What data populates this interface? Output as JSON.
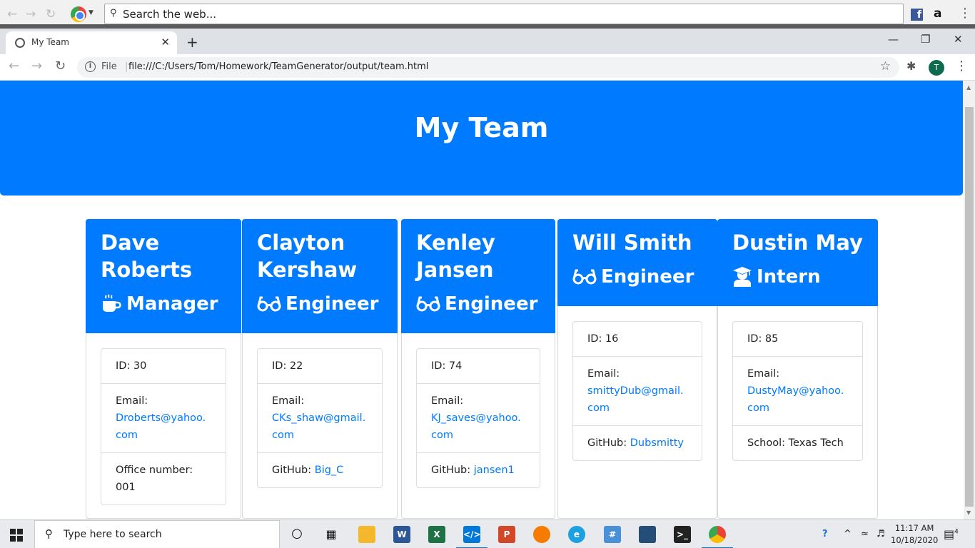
{
  "outer": {
    "search_placeholder": "Search the web..."
  },
  "browser": {
    "tab_title": "My Team",
    "file_label": "File",
    "url": "file:///C:/Users/Tom/Homework/TeamGenerator/output/team.html",
    "profile_initial": "T"
  },
  "page": {
    "title": "My Team",
    "members": [
      {
        "name": "Dave Roberts",
        "role": "Manager",
        "icon": "coffee-icon",
        "id_text": "ID: 30",
        "email_label": "Email:",
        "email": "Droberts@yahoo.com",
        "extra_label": "Office number:",
        "extra_value": "001"
      },
      {
        "name": "Clayton Kershaw",
        "role": "Engineer",
        "icon": "glasses-icon",
        "id_text": "ID: 22",
        "email_label": "Email:",
        "email": "CKs_shaw@gmail.com",
        "extra_label": "GitHub:",
        "extra_value": "Big_C"
      },
      {
        "name": "Kenley Jansen",
        "role": "Engineer",
        "icon": "glasses-icon",
        "id_text": "ID: 74",
        "email_label": "Email:",
        "email": "KJ_saves@yahoo.com",
        "extra_label": "GitHub:",
        "extra_value": "jansen1"
      },
      {
        "name": "Will Smith",
        "role": "Engineer",
        "icon": "glasses-icon",
        "id_text": "ID: 16",
        "email_label": "Email:",
        "email": "smittyDub@gmail.com",
        "extra_label": "GitHub:",
        "extra_value": "Dubsmitty"
      },
      {
        "name": "Dustin May",
        "role": "Intern",
        "icon": "graduate-icon",
        "id_text": "ID: 85",
        "email_label": "Email:",
        "email": "DustyMay@yahoo.com",
        "extra_label": "School:",
        "extra_value": "Texas Tech"
      }
    ]
  },
  "taskbar": {
    "search_placeholder": "Type here to search",
    "time": "11:17 AM",
    "date": "10/18/2020",
    "notifications": "4"
  },
  "colors": {
    "primary": "#007bff"
  }
}
